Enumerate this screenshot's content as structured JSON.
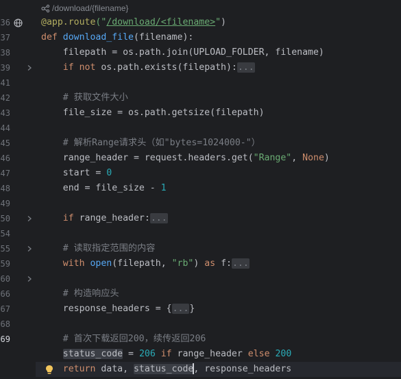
{
  "breadcrumb_hint": "/download/{filename}",
  "colors": {
    "background": "#1e1f22",
    "current_line": "#26282e",
    "keyword": "#cf8e6d",
    "function": "#56a8f5",
    "decorator": "#b3ae60",
    "string": "#6aab73",
    "number": "#2aacb8",
    "comment": "#7a7e85",
    "text": "#bcbec4"
  },
  "icons": {
    "line_36": "globe-icon",
    "line_69": "lightbulb-icon",
    "fold": "chevron-right-icon"
  },
  "line_numbers": [
    "36",
    "37",
    "38",
    "39",
    "41",
    "42",
    "43",
    "44",
    "45",
    "46",
    "47",
    "48",
    "49",
    "50",
    "54",
    "55",
    "59",
    "60",
    "66",
    "67",
    "68",
    "69"
  ],
  "current_line": "69",
  "lines": [
    {
      "num": "36",
      "tokens": [
        {
          "t": "@app.route",
          "c": "dec"
        },
        {
          "t": "(\"",
          "c": "str"
        },
        {
          "t": "/download/<filename>",
          "c": "url"
        },
        {
          "t": "\"",
          "c": "str"
        },
        {
          "t": ")",
          "c": ""
        }
      ]
    },
    {
      "num": "37",
      "tokens": [
        {
          "t": "def ",
          "c": "kw"
        },
        {
          "t": "download_file",
          "c": "fn"
        },
        {
          "t": "(filename):",
          "c": ""
        }
      ]
    },
    {
      "num": "38",
      "tokens": [
        {
          "t": "    filepath = os.path.join(UPLOAD_FOLDER, filename)",
          "c": ""
        }
      ]
    },
    {
      "num": "39",
      "tokens": [
        {
          "t": "    ",
          "c": ""
        },
        {
          "t": "if not ",
          "c": "kw"
        },
        {
          "t": "os.path.exists(filepath):",
          "c": ""
        },
        {
          "t": "...",
          "c": "fld"
        }
      ]
    },
    {
      "num": "41",
      "tokens": []
    },
    {
      "num": "42",
      "tokens": [
        {
          "t": "    # 获取文件大小",
          "c": "cm"
        }
      ]
    },
    {
      "num": "43",
      "tokens": [
        {
          "t": "    file_size = os.path.getsize(filepath)",
          "c": ""
        }
      ]
    },
    {
      "num": "44",
      "tokens": []
    },
    {
      "num": "45",
      "tokens": [
        {
          "t": "    # 解析Range请求头（如\"bytes=1024000-\"）",
          "c": "cm"
        }
      ]
    },
    {
      "num": "46",
      "tokens": [
        {
          "t": "    range_header = request.headers.get(",
          "c": ""
        },
        {
          "t": "\"Range\"",
          "c": "str"
        },
        {
          "t": ", ",
          "c": ""
        },
        {
          "t": "None",
          "c": "kw"
        },
        {
          "t": ")",
          "c": ""
        }
      ]
    },
    {
      "num": "47",
      "tokens": [
        {
          "t": "    start = ",
          "c": ""
        },
        {
          "t": "0",
          "c": "num"
        }
      ]
    },
    {
      "num": "48",
      "tokens": [
        {
          "t": "    end = file_size - ",
          "c": ""
        },
        {
          "t": "1",
          "c": "num"
        }
      ]
    },
    {
      "num": "49",
      "tokens": []
    },
    {
      "num": "50",
      "tokens": [
        {
          "t": "    ",
          "c": ""
        },
        {
          "t": "if ",
          "c": "kw"
        },
        {
          "t": "range_header:",
          "c": ""
        },
        {
          "t": "...",
          "c": "fld"
        }
      ]
    },
    {
      "num": "54",
      "tokens": []
    },
    {
      "num": "55",
      "tokens": [
        {
          "t": "    # 读取指定范围的内容",
          "c": "cm"
        }
      ]
    },
    {
      "num": "59",
      "tokens": [
        {
          "t": "    ",
          "c": ""
        },
        {
          "t": "with ",
          "c": "kw"
        },
        {
          "t": "open",
          "c": "fn"
        },
        {
          "t": "(filepath, ",
          "c": ""
        },
        {
          "t": "\"rb\"",
          "c": "str"
        },
        {
          "t": ") ",
          "c": ""
        },
        {
          "t": "as ",
          "c": "kw"
        },
        {
          "t": "f:",
          "c": ""
        },
        {
          "t": "...",
          "c": "fld"
        }
      ]
    },
    {
      "num": "60",
      "tokens": []
    },
    {
      "num": "66",
      "tokens": [
        {
          "t": "    # 构造响应头",
          "c": "cm"
        }
      ]
    },
    {
      "num": "67",
      "tokens": [
        {
          "t": "    response_headers = {",
          "c": ""
        },
        {
          "t": "...",
          "c": "fld"
        },
        {
          "t": "}",
          "c": ""
        }
      ]
    },
    {
      "num": "68",
      "tokens": []
    },
    {
      "num": "69",
      "tokens": [
        {
          "t": "    # 首次下载返回200，续传返回206",
          "c": "cm"
        }
      ]
    },
    {
      "num": "",
      "tokens": [
        {
          "t": "    ",
          "c": ""
        },
        {
          "t": "status_code",
          "c": "hl"
        },
        {
          "t": " = ",
          "c": ""
        },
        {
          "t": "206 ",
          "c": "num"
        },
        {
          "t": "if ",
          "c": "kw"
        },
        {
          "t": "range_header ",
          "c": ""
        },
        {
          "t": "else ",
          "c": "kw"
        },
        {
          "t": "200",
          "c": "num"
        }
      ]
    },
    {
      "num": "",
      "tokens": [
        {
          "t": "    ",
          "c": ""
        },
        {
          "t": "return ",
          "c": "kw"
        },
        {
          "t": "data, ",
          "c": ""
        },
        {
          "t": "status_code",
          "c": "hl"
        },
        {
          "t": "CARET",
          "c": "caret"
        },
        {
          "t": ", response_headers",
          "c": ""
        }
      ]
    }
  ]
}
